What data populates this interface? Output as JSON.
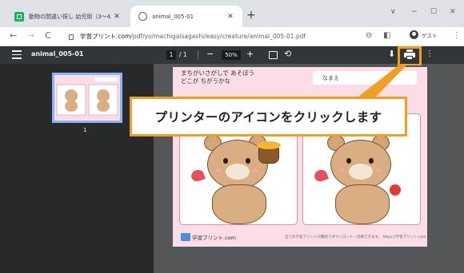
{
  "browser": {
    "tabs": [
      {
        "title": "動物の間違い探し 幼児用（3〜4歳",
        "active": false
      },
      {
        "title": "animal_005-01",
        "active": true
      }
    ],
    "new_tab_symbol": "+",
    "window_controls": [
      "∨",
      "−",
      "☐",
      "✕"
    ],
    "url_domain": "学習プリント.com",
    "url_path": "/pdf/yo/machigaisagashi/easy/creature/animal_005-01.pdf",
    "profile_label": "ゲスト",
    "nav": {
      "back": "←",
      "forward": "→",
      "reload": "C"
    }
  },
  "pdf_toolbar": {
    "file_name": "animal_005-01",
    "current_page": "1",
    "total_pages": "/ 1",
    "zoom": "50%",
    "zoom_out": "−",
    "zoom_in": "+",
    "rotate": "⟲",
    "download": "⬇",
    "more": "⋮"
  },
  "sidebar": {
    "thumbnail_page_number": "1"
  },
  "pdf_page": {
    "instruction_line1": "まちがいさがしで あそぼう",
    "instruction_line2": "どこが ちがうかな",
    "name_label": "なまえ",
    "footer_site": "学習プリント.com",
    "footer_note": "全ての学習プリントが無料でダウンロード・印刷できます。 https://学習プリント.com"
  },
  "callout": {
    "text": "プリンターのアイコンをクリックします"
  },
  "colors": {
    "highlight": "#f0a01e",
    "pdf_toolbar": "#323639",
    "page_bg": "#fadde6"
  }
}
